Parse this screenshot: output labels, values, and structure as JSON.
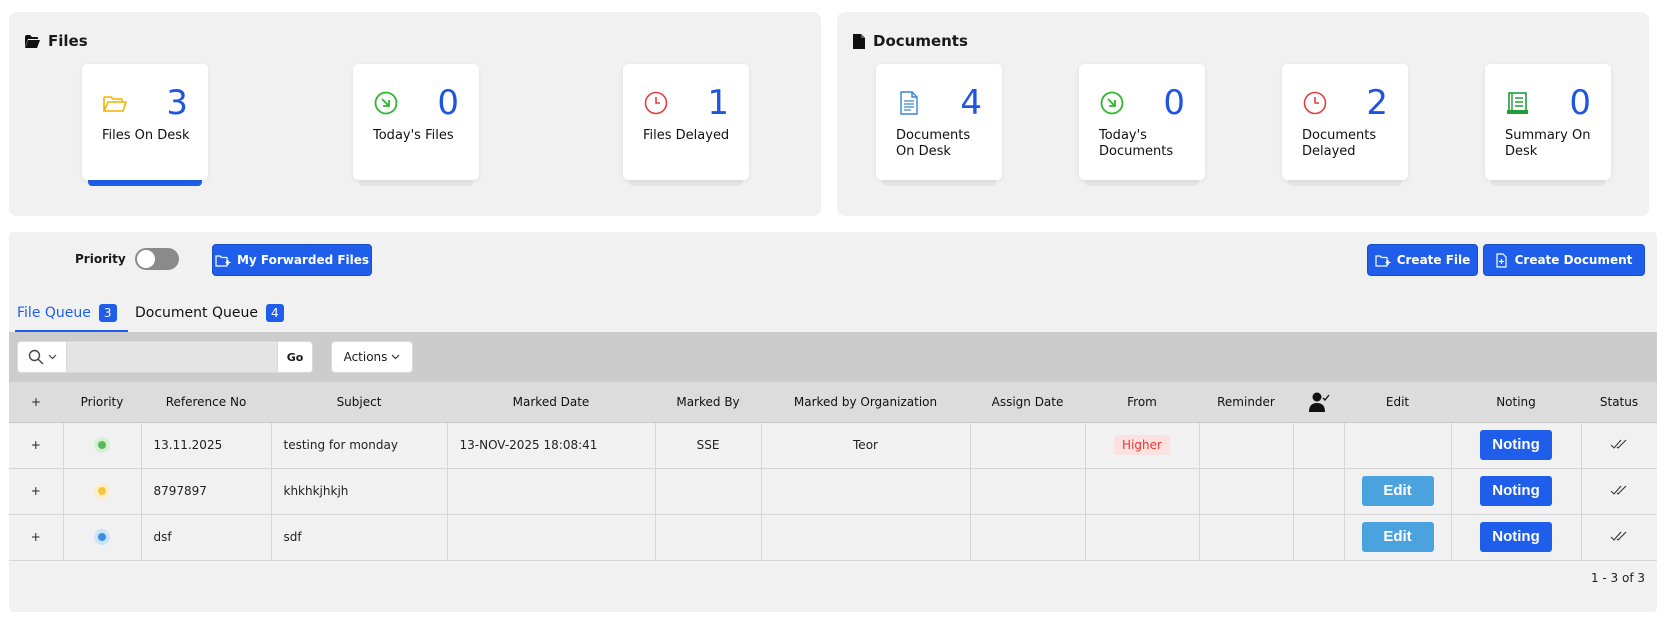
{
  "files_panel": {
    "title": "Files",
    "cards": [
      {
        "count": "3",
        "label": "Files On Desk",
        "icon": "folder-open-icon",
        "active": true
      },
      {
        "count": "0",
        "label": "Today's Files",
        "icon": "arrow-circle-icon"
      },
      {
        "count": "1",
        "label": "Files Delayed",
        "icon": "clock-icon"
      }
    ]
  },
  "documents_panel": {
    "title": "Documents",
    "cards": [
      {
        "count": "4",
        "label": "Documents On Desk",
        "icon": "document-icon"
      },
      {
        "count": "0",
        "label": "Today's Documents",
        "icon": "arrow-circle-icon"
      },
      {
        "count": "2",
        "label": "Documents Delayed",
        "icon": "clock-icon"
      },
      {
        "count": "0",
        "label": "Summary On Desk",
        "icon": "scroll-icon"
      }
    ]
  },
  "controls": {
    "priority_label": "Priority",
    "my_forwarded_label": "My Forwarded Files",
    "create_file_label": "Create File",
    "create_document_label": "Create Document"
  },
  "tabs": [
    {
      "label": "File Queue",
      "count": "3",
      "active": true
    },
    {
      "label": "Document Queue",
      "count": "4"
    }
  ],
  "toolbar": {
    "search_value": "",
    "go_label": "Go",
    "actions_label": "Actions"
  },
  "table": {
    "columns": [
      "+",
      "Priority",
      "Reference No",
      "Subject",
      "Marked Date",
      "Marked By",
      "Marked by Organization",
      "Assign Date",
      "From",
      "Reminder",
      "",
      "Edit",
      "Noting",
      "Status"
    ],
    "rows": [
      {
        "priority_color": "#5cb85c",
        "reference": "13.11.2025",
        "subject": "testing for monday",
        "marked_date": "13-NOV-2025 18:08:41",
        "marked_by": "SSE",
        "organization": "Teor",
        "assign_date": "",
        "from": "Higher",
        "reminder": "",
        "edit": "",
        "noting": "Noting"
      },
      {
        "priority_color": "#f5c542",
        "reference": "8797897",
        "subject": "khkhkjhkjh",
        "marked_date": "",
        "marked_by": "",
        "organization": "",
        "assign_date": "",
        "from": "",
        "reminder": "",
        "edit": "Edit",
        "noting": "Noting"
      },
      {
        "priority_color": "#3b8fe0",
        "reference": "dsf",
        "subject": "sdf",
        "marked_date": "",
        "marked_by": "",
        "organization": "",
        "assign_date": "",
        "from": "",
        "reminder": "",
        "edit": "Edit",
        "noting": "Noting"
      }
    ]
  },
  "pager": "1 - 3 of 3",
  "colors": {
    "accent": "#1e5eea",
    "edit": "#4aa3df",
    "higher_bg": "#fde0e0",
    "higher_fg": "#e53935"
  }
}
